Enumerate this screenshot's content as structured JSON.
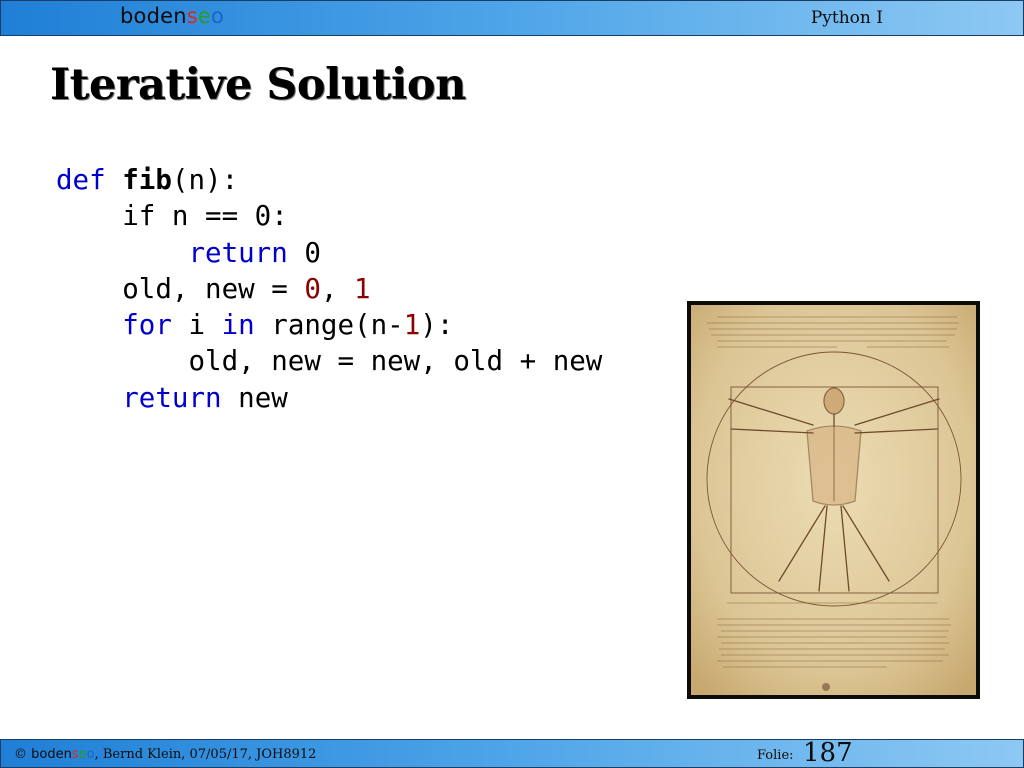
{
  "header": {
    "logo_parts": [
      "boden",
      "s",
      "e",
      "o"
    ],
    "course": "Python I"
  },
  "title": "Iterative Solution",
  "code": {
    "l1": {
      "def": "def ",
      "name": "fib",
      "rest": "(n):"
    },
    "l2": {
      "indent": "    ",
      "text": "if n == 0:"
    },
    "l3": {
      "indent": "        ",
      "kw": "return",
      "rest": " 0"
    },
    "l4": {
      "indent": "    ",
      "text": "old, new = ",
      "n0": "0",
      "comma": ", ",
      "n1": "1"
    },
    "l5": {
      "indent": "    ",
      "kw1": "for",
      "mid1": " i ",
      "kw2": "in",
      "mid2": " range(n-",
      "n1": "1",
      "end": "):"
    },
    "l6": {
      "indent": "        ",
      "text": "old, new = new, old + new"
    },
    "l7": {
      "indent": "    ",
      "kw": "return",
      "rest": " new"
    }
  },
  "image": {
    "name": "Vitruvian Man drawing"
  },
  "footer": {
    "copyright_symbol": "© ",
    "brand_parts": [
      "boden",
      "s",
      "e",
      "o"
    ],
    "author_text": ", Bernd Klein, 07/05/17, JOH8912",
    "folie_label": "Folie:",
    "folie_number": "187"
  },
  "colors": {
    "header_bar": "#4ea5e8",
    "keyword": "#0000cc",
    "number": "#8b0000",
    "parchment": "#e6d2a6"
  }
}
